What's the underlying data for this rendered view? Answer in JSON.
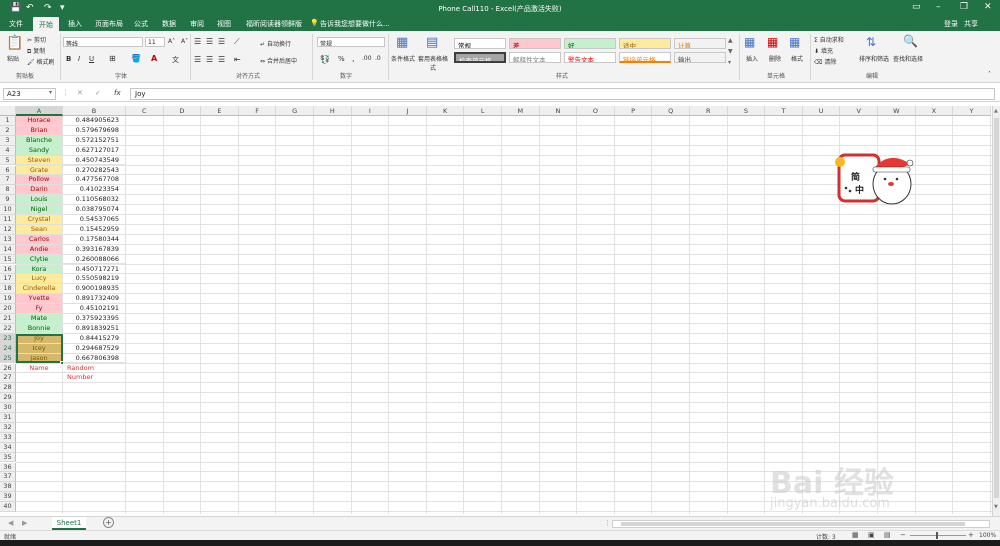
{
  "window": {
    "title": "Phone Call110 - Excel(产品激活失败)",
    "minimize": "–",
    "restore": "❐",
    "close": "✕"
  },
  "quick_access": {
    "save_icon": "💾",
    "undo_icon": "↶",
    "redo_icon": "↷",
    "more_icon": "▾"
  },
  "tabs": [
    "文件",
    "开始",
    "插入",
    "页面布局",
    "公式",
    "数据",
    "审阅",
    "视图",
    "福昕阅读器领鲜版"
  ],
  "active_tab": "开始",
  "tell_me": "告诉我您想要做什么...",
  "login": "登录",
  "share": "共享",
  "clipboard": {
    "paste": "粘贴",
    "cut": "剪切",
    "copy": "复制",
    "format_painter": "格式刷",
    "group": "剪贴板"
  },
  "font": {
    "name": "等线",
    "size": "11",
    "grow": "A˄",
    "shrink": "A˅",
    "bold": "B",
    "italic": "I",
    "underline": "U",
    "group": "字体"
  },
  "alignment": {
    "wrap": "自动换行",
    "merge": "合并后居中",
    "group": "对齐方式"
  },
  "number": {
    "format": "常规",
    "percent": "%",
    "comma": ",",
    "group": "数字"
  },
  "styles": {
    "conditional": "条件格式",
    "table": "套用表格格式",
    "group": "样式",
    "items": [
      {
        "label": "常规",
        "bg": "#ffffff",
        "color": "#000000"
      },
      {
        "label": "差",
        "bg": "#ffc7ce",
        "color": "#9c0006"
      },
      {
        "label": "好",
        "bg": "#c6efce",
        "color": "#006100"
      },
      {
        "label": "适中",
        "bg": "#ffeb9c",
        "color": "#9c5700"
      },
      {
        "label": "计算",
        "bg": "#f2f2f2",
        "color": "#fa7d00"
      },
      {
        "label": "检查单元格",
        "bg": "#a5a5a5",
        "color": "#ffffff"
      },
      {
        "label": "解释性文本",
        "bg": "#ffffff",
        "color": "#7f7f7f"
      },
      {
        "label": "警告文本",
        "bg": "#ffffff",
        "color": "#ff0000"
      },
      {
        "label": "链接单元格",
        "bg": "#ffffff",
        "color": "#fa7d00"
      },
      {
        "label": "输出",
        "bg": "#f2f2f2",
        "color": "#3f3f3f"
      }
    ]
  },
  "cells_group": {
    "insert": "插入",
    "delete": "删除",
    "format": "格式",
    "group": "单元格"
  },
  "editing": {
    "autosum": "自动求和",
    "fill": "填充",
    "clear": "清除",
    "sort": "排序和筛选",
    "find": "查找和选择",
    "group": "编辑"
  },
  "formula_bar": {
    "name_box": "A23",
    "cancel": "✕",
    "enter": "✓",
    "fx": "fx",
    "value": "Joy"
  },
  "columns": [
    "A",
    "B",
    "C",
    "D",
    "E",
    "F",
    "G",
    "H",
    "I",
    "J",
    "K",
    "L",
    "M",
    "N",
    "O",
    "P",
    "Q",
    "R",
    "S",
    "T",
    "U",
    "V",
    "W",
    "X",
    "Y"
  ],
  "row_count": 40,
  "data_rows": [
    {
      "name": "Horace",
      "value": "0.484905623",
      "fill": "#ffc7ce",
      "color": "#9c0006"
    },
    {
      "name": "Brian",
      "value": "0.579679698",
      "fill": "#ffc7ce",
      "color": "#9c0006"
    },
    {
      "name": "Blanche",
      "value": "0.572152751",
      "fill": "#c6efce",
      "color": "#006100"
    },
    {
      "name": "Sandy",
      "value": "0.627127017",
      "fill": "#c6efce",
      "color": "#006100"
    },
    {
      "name": "Steven",
      "value": "0.450743549",
      "fill": "#ffeb9c",
      "color": "#9c5700"
    },
    {
      "name": "Grate",
      "value": "0.270282543",
      "fill": "#ffeb9c",
      "color": "#9c5700"
    },
    {
      "name": "Pollow",
      "value": "0.477567708",
      "fill": "#ffc7ce",
      "color": "#9c0006"
    },
    {
      "name": "Darin",
      "value": "0.41023354",
      "fill": "#ffc7ce",
      "color": "#9c0006"
    },
    {
      "name": "Louis",
      "value": "0.110568032",
      "fill": "#c6efce",
      "color": "#006100"
    },
    {
      "name": "Nigel",
      "value": "0.038795074",
      "fill": "#c6efce",
      "color": "#006100"
    },
    {
      "name": "Crystal",
      "value": "0.54537065",
      "fill": "#ffeb9c",
      "color": "#9c5700"
    },
    {
      "name": "Sean",
      "value": "0.15452959",
      "fill": "#ffeb9c",
      "color": "#9c5700"
    },
    {
      "name": "Carlos",
      "value": "0.17580344",
      "fill": "#ffc7ce",
      "color": "#9c0006"
    },
    {
      "name": "Andie",
      "value": "0.393167839",
      "fill": "#ffc7ce",
      "color": "#9c0006"
    },
    {
      "name": "Clytie",
      "value": "0.260088066",
      "fill": "#c6efce",
      "color": "#006100"
    },
    {
      "name": "Kora",
      "value": "0.450717271",
      "fill": "#c6efce",
      "color": "#006100"
    },
    {
      "name": "Lucy",
      "value": "0.550598219",
      "fill": "#ffeb9c",
      "color": "#9c5700"
    },
    {
      "name": "Cinderella",
      "value": "0.900198935",
      "fill": "#ffeb9c",
      "color": "#9c5700"
    },
    {
      "name": "Yvette",
      "value": "0.891732409",
      "fill": "#ffc7ce",
      "color": "#9c0006"
    },
    {
      "name": "Fy",
      "value": "0.45102191",
      "fill": "#ffc7ce",
      "color": "#9c0006"
    },
    {
      "name": "Mate",
      "value": "0.375923395",
      "fill": "#c6efce",
      "color": "#006100"
    },
    {
      "name": "Bonnie",
      "value": "0.891839251",
      "fill": "#c6efce",
      "color": "#006100"
    },
    {
      "name": "Joy",
      "value": "0.84415279",
      "fill": "#d6b86a",
      "color": "#7a5a00"
    },
    {
      "name": "Icey",
      "value": "0.294687529",
      "fill": "#d6b86a",
      "color": "#7a5a00"
    },
    {
      "name": "Jason",
      "value": "0.667806398",
      "fill": "#d6b86a",
      "color": "#7a5a00"
    },
    {
      "name": "Name",
      "value": "Random Number",
      "fill": "#ffffff",
      "color": "#e03030"
    }
  ],
  "sticker": {
    "char1": "简",
    "char2": "中"
  },
  "sheet_tab": "Sheet1",
  "add_sheet": "+",
  "status": {
    "ready": "就绪",
    "count": "计数: 3",
    "zoom": "100%"
  },
  "watermark": {
    "brand": "Bai 经验",
    "url": "jingyan.baidu.com"
  }
}
